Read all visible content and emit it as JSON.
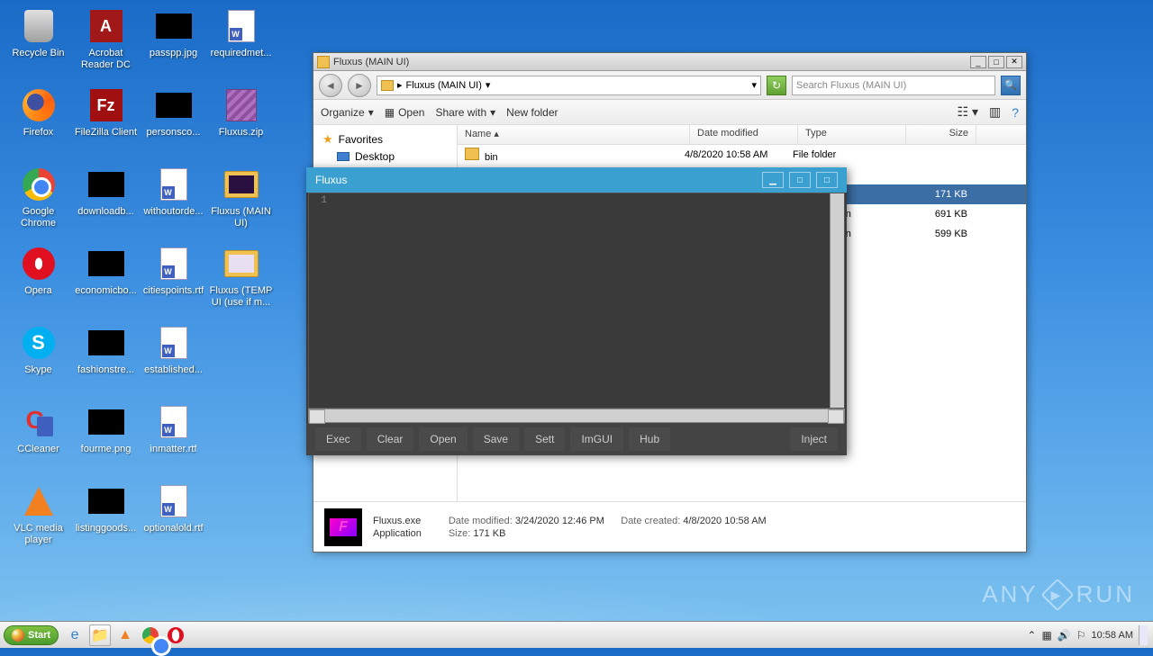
{
  "desktop": {
    "icons": [
      {
        "label": "Recycle Bin",
        "type": "recycle"
      },
      {
        "label": "Acrobat Reader DC",
        "type": "adobe",
        "multi": true
      },
      {
        "label": "passpp.jpg",
        "type": "black"
      },
      {
        "label": "requiredmet...",
        "type": "doc"
      },
      {
        "label": "Firefox",
        "type": "firefox"
      },
      {
        "label": "FileZilla Client",
        "type": "filezilla"
      },
      {
        "label": "personsco...",
        "type": "black"
      },
      {
        "label": "Fluxus.zip",
        "type": "winrar"
      },
      {
        "label": "Google Chrome",
        "type": "chrome",
        "multi": true
      },
      {
        "label": "downloadb...",
        "type": "black"
      },
      {
        "label": "withoutorde...",
        "type": "doc"
      },
      {
        "label": "Fluxus (MAIN UI)",
        "type": "folder-dark",
        "multi": true
      },
      {
        "label": "Opera",
        "type": "opera"
      },
      {
        "label": "economicbo...",
        "type": "black"
      },
      {
        "label": "citiespoints.rtf",
        "type": "doc"
      },
      {
        "label": "Fluxus (TEMP UI (use if m...",
        "type": "folder-light",
        "multi": true
      },
      {
        "label": "Skype",
        "type": "skype"
      },
      {
        "label": "fashionstre...",
        "type": "black"
      },
      {
        "label": "established...",
        "type": "doc"
      },
      {
        "label": "",
        "type": "empty"
      },
      {
        "label": "CCleaner",
        "type": "ccleaner"
      },
      {
        "label": "fourme.png",
        "type": "black"
      },
      {
        "label": "inmatter.rtf",
        "type": "doc"
      },
      {
        "label": "",
        "type": "empty"
      },
      {
        "label": "VLC media player",
        "type": "vlc",
        "multi": true
      },
      {
        "label": "listinggoods...",
        "type": "black"
      },
      {
        "label": "optionalold.rtf",
        "type": "doc"
      }
    ]
  },
  "explorer": {
    "title": "Fluxus (MAIN UI)",
    "breadcrumb": "Fluxus (MAIN UI)",
    "search_placeholder": "Search Fluxus (MAIN UI)",
    "toolbar": {
      "organize": "Organize",
      "open": "Open",
      "share": "Share with",
      "newfolder": "New folder"
    },
    "sidebar": {
      "favorites": "Favorites",
      "desktop": "Desktop"
    },
    "columns": {
      "name": "Name",
      "date": "Date modified",
      "type": "Type",
      "size": "Size"
    },
    "rows": [
      {
        "name": "bin",
        "date": "4/8/2020 10:58 AM",
        "type": "File folder",
        "size": "",
        "icon": "folder"
      },
      {
        "name": "",
        "date": "",
        "type": "er",
        "size": "",
        "icon": "folder",
        "partial": true
      },
      {
        "name": "",
        "date": "",
        "type": "ion",
        "size": "171 KB",
        "icon": "app",
        "selected": true
      },
      {
        "name": "",
        "date": "",
        "type": "ion extension",
        "size": "691 KB",
        "icon": "",
        "partial": true
      },
      {
        "name": "",
        "date": "",
        "type": "ion extension",
        "size": "599 KB",
        "icon": "",
        "partial": true
      }
    ],
    "details": {
      "name": "Fluxus.exe",
      "subtype": "Application",
      "date_modified_label": "Date modified:",
      "date_modified": "3/24/2020 12:46 PM",
      "date_created_label": "Date created:",
      "date_created": "4/8/2020 10:58 AM",
      "size_label": "Size:",
      "size": "171 KB"
    }
  },
  "fluxus": {
    "title": "Fluxus",
    "line1": "1",
    "buttons": {
      "exec": "Exec",
      "clear": "Clear",
      "open": "Open",
      "save": "Save",
      "sett": "Sett",
      "imgui": "ImGUI",
      "hub": "Hub",
      "inject": "Inject"
    }
  },
  "taskbar": {
    "start": "Start",
    "clock": "10:58 AM"
  },
  "watermark": {
    "text": "ANY",
    "text2": "RUN"
  }
}
